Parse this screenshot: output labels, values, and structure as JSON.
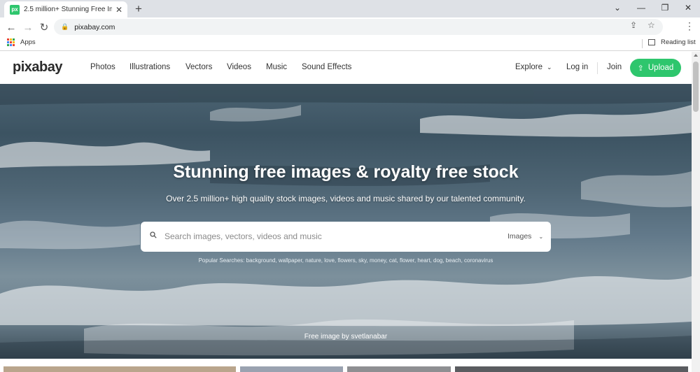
{
  "browser": {
    "tab_title": "2.5 million+ Stunning Free Images",
    "favicon_text": "px",
    "url": "pixabay.com",
    "bookmarks": {
      "apps_label": "Apps",
      "reading_list_label": "Reading list"
    }
  },
  "header": {
    "logo": "pixabay",
    "nav": [
      "Photos",
      "Illustrations",
      "Vectors",
      "Videos",
      "Music",
      "Sound Effects"
    ],
    "explore_label": "Explore",
    "login_label": "Log in",
    "join_label": "Join",
    "upload_label": "Upload"
  },
  "hero": {
    "title": "Stunning free images & royalty free stock",
    "subtitle": "Over 2.5 million+ high quality stock images, videos and music shared by our talented community.",
    "search": {
      "placeholder": "Search images, vectors, videos and music",
      "type_selected": "Images"
    },
    "popular_searches": "Popular Searches: background, wallpaper, nature, love, flowers, sky, money, cat, flower, heart, dog, beach, coronavirus",
    "credit": "Free image by svetlanabar"
  },
  "colors": {
    "brand": "#2ec66d",
    "apps_icon": [
      "#ea4335",
      "#fbbc05",
      "#34a853",
      "#4285f4",
      "#ea4335",
      "#fbbc05",
      "#34a853",
      "#4285f4",
      "#ea4335"
    ],
    "thumbs": [
      "#b9a58c",
      "#9aa2b0",
      "#8e8f92",
      "#5a5c60"
    ]
  },
  "icons": {
    "back": "arrow-left-icon",
    "forward": "arrow-right-icon",
    "reload": "reload-icon",
    "share": "share-icon",
    "star": "star-icon",
    "search": "search-icon",
    "upload": "upload-icon"
  }
}
